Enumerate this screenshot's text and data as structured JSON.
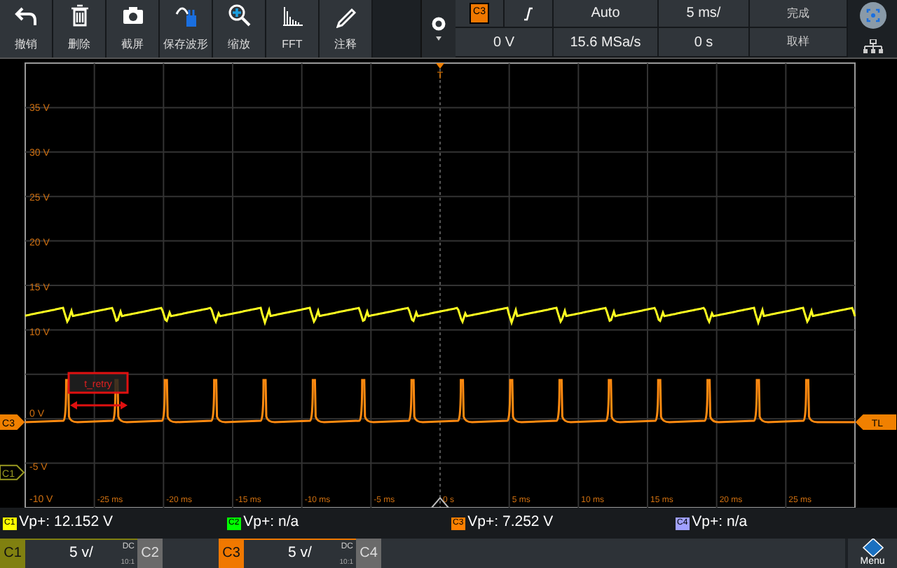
{
  "toolbar": {
    "buttons": [
      {
        "label": "撤销",
        "kind": "undo"
      },
      {
        "label": "删除",
        "kind": "trash"
      },
      {
        "label": "截屏",
        "kind": "camera"
      },
      {
        "label": "保存波形",
        "kind": "save"
      },
      {
        "label": "缩放",
        "kind": "zoom"
      },
      {
        "label": "FFT",
        "kind": "fft"
      },
      {
        "label": "注释",
        "kind": "pen"
      }
    ]
  },
  "trigger": {
    "source": "C3",
    "mode": "Auto",
    "time_base": "5 ms/",
    "run_state": "完成",
    "level": "0 V",
    "sample_rate": "15.6 MSa/s",
    "position": "0 s",
    "acquire_mode": "取样"
  },
  "plot": {
    "volt_labels": [
      "35 V",
      "30 V",
      "25 V",
      "20 V",
      "15 V",
      "10 V",
      "0 V",
      "-5 V",
      "-10 V"
    ],
    "time_labels": [
      "-25 ms",
      "-20 ms",
      "-15 ms",
      "-10 ms",
      "-5 ms",
      "0 s",
      "5 ms",
      "10 ms",
      "15 ms",
      "20 ms",
      "25 ms"
    ],
    "annotation": {
      "text": "t_retry"
    },
    "trigger_marker": {
      "label": "T"
    },
    "markers": [
      {
        "label": "C3",
        "kind": "channel",
        "filled": true,
        "color": "#f08000"
      },
      {
        "label": "C1",
        "kind": "channel",
        "filled": false,
        "color": "#9a9a20"
      },
      {
        "label": "TL",
        "kind": "trigger_level",
        "filled": true,
        "color": "#f08000"
      }
    ]
  },
  "measurements": [
    {
      "channel": "C1",
      "text": "Vp+: 12.152 V",
      "color": "#ffff00"
    },
    {
      "channel": "C2",
      "text": "Vp+: n/a",
      "color": "#00ff00"
    },
    {
      "channel": "C3",
      "text": "Vp+: 7.252 V",
      "color": "#ff8000"
    },
    {
      "channel": "C4",
      "text": "Vp+: n/a",
      "color": "#a0a0ff"
    }
  ],
  "channels": [
    {
      "label": "C1",
      "active": true,
      "color": "#808010",
      "scale": "5 v/",
      "coupling": "DC",
      "probe": "10:1"
    },
    {
      "label": "C2",
      "active": false
    },
    {
      "label": "C3",
      "active": true,
      "color": "#f07800",
      "scale": "5 v/",
      "coupling": "DC",
      "probe": "10:1"
    },
    {
      "label": "C4",
      "active": false
    }
  ],
  "menu": {
    "label": "Menu"
  }
}
